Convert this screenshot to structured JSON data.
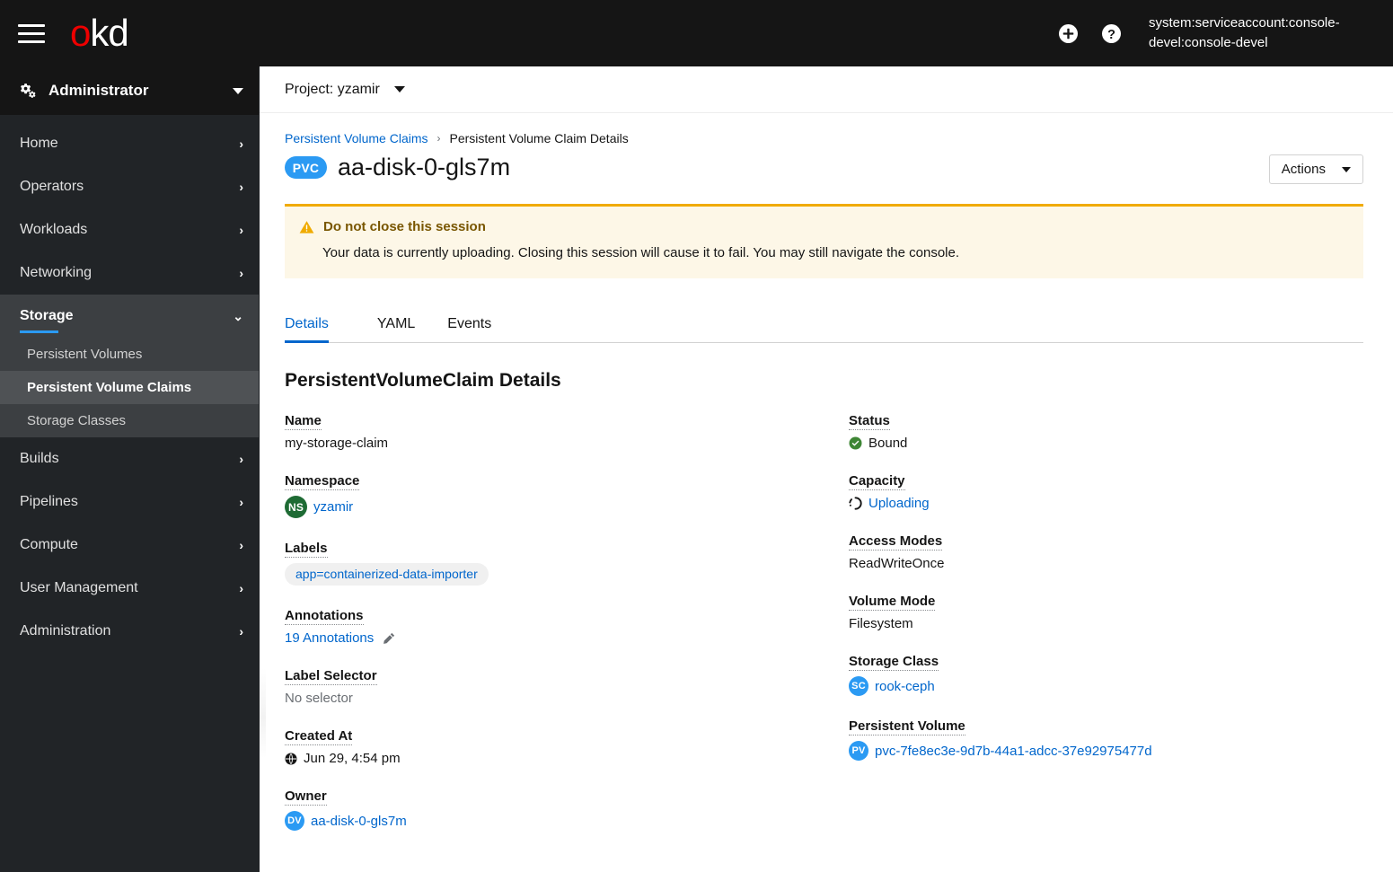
{
  "masthead": {
    "menu_icon": "hamburger-icon",
    "logo_o": "o",
    "logo_kd": "kd",
    "create_icon": "plus-circle-icon",
    "help_icon": "question-circle-icon",
    "user": "system:serviceaccount:console-devel:console-devel"
  },
  "sidebar": {
    "perspective": {
      "icon": "cogs-icon",
      "label": "Administrator",
      "caret": "chevron-down-icon"
    },
    "items": [
      {
        "label": "Home",
        "expanded": false
      },
      {
        "label": "Operators",
        "expanded": false
      },
      {
        "label": "Workloads",
        "expanded": false
      },
      {
        "label": "Networking",
        "expanded": false
      },
      {
        "label": "Storage",
        "expanded": true,
        "children": [
          {
            "label": "Persistent Volumes",
            "active": false
          },
          {
            "label": "Persistent Volume Claims",
            "active": true
          },
          {
            "label": "Storage Classes",
            "active": false
          }
        ]
      },
      {
        "label": "Builds",
        "expanded": false
      },
      {
        "label": "Pipelines",
        "expanded": false
      },
      {
        "label": "Compute",
        "expanded": false
      },
      {
        "label": "User Management",
        "expanded": false
      },
      {
        "label": "Administration",
        "expanded": false
      }
    ]
  },
  "project_bar": {
    "label": "Project: yzamir",
    "caret": "caret-down-icon"
  },
  "breadcrumb": {
    "parent": "Persistent Volume Claims",
    "separator": "›",
    "current": "Persistent Volume Claim Details"
  },
  "page": {
    "badge": "PVC",
    "title": "aa-disk-0-gls7m",
    "actions_label": "Actions"
  },
  "alert": {
    "icon": "warning-triangle-icon",
    "title": "Do not close this session",
    "body": "Your data is currently uploading. Closing this session will cause it to fail. You may still navigate the console.",
    "accent_color": "#f0ab00",
    "background_color": "#fdf7e7"
  },
  "tabs": [
    {
      "label": "Details",
      "active": true
    },
    {
      "label": "YAML",
      "active": false
    },
    {
      "label": "Events",
      "active": false
    }
  ],
  "details": {
    "heading": "PersistentVolumeClaim Details",
    "left": [
      {
        "term": "Name",
        "value": "my-storage-claim",
        "type": "text"
      },
      {
        "term": "Namespace",
        "value": "yzamir",
        "type": "link-badge",
        "badge": "NS",
        "badge_color": "#1e6b34"
      },
      {
        "term": "Labels",
        "value": "app=containerized-data-importer",
        "type": "chip"
      },
      {
        "term": "Annotations",
        "value": "19 Annotations",
        "type": "link-edit",
        "edit_icon": "pencil-icon"
      },
      {
        "term": "Label Selector",
        "value": "No selector",
        "type": "muted"
      },
      {
        "term": "Created At",
        "value": "Jun 29, 4:54 pm",
        "type": "timestamp",
        "icon": "globe-icon"
      },
      {
        "term": "Owner",
        "value": "aa-disk-0-gls7m",
        "type": "link-badge",
        "badge": "DV",
        "badge_color": "#2b9af3"
      }
    ],
    "right": [
      {
        "term": "Status",
        "value": "Bound",
        "type": "status-ok",
        "icon": "check-circle-icon",
        "icon_color": "#3e8635"
      },
      {
        "term": "Capacity",
        "value": "Uploading",
        "type": "status-loading",
        "icon": "spinner-icon"
      },
      {
        "term": "Access Modes",
        "value": "ReadWriteOnce",
        "type": "text"
      },
      {
        "term": "Volume Mode",
        "value": "Filesystem",
        "type": "text"
      },
      {
        "term": "Storage Class",
        "value": "rook-ceph",
        "type": "link-badge",
        "badge": "SC",
        "badge_color": "#2b9af3"
      },
      {
        "term": "Persistent Volume",
        "value": "pvc-7fe8ec3e-9d7b-44a1-adcc-37e92975477d",
        "type": "link-badge",
        "badge": "PV",
        "badge_color": "#2b9af3"
      }
    ]
  },
  "colors": {
    "brand_red": "#ee0000",
    "link_blue": "#06c",
    "accent_blue": "#2b9af3",
    "masthead_bg": "#151515",
    "sidebar_bg": "#212427",
    "sidebar_active_bg": "#4f5255",
    "warning": "#f0ab00",
    "success": "#3e8635"
  }
}
